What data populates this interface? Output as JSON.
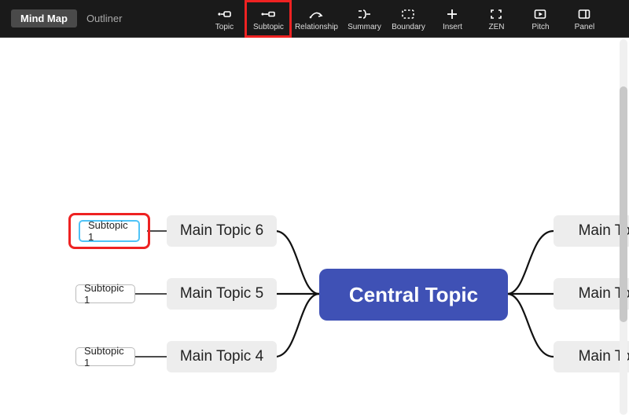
{
  "view_tabs": {
    "mindmap": "Mind Map",
    "outliner": "Outliner"
  },
  "tools": {
    "topic": "Topic",
    "subtopic": "Subtopic",
    "relationship": "Relationship",
    "summary": "Summary",
    "boundary": "Boundary",
    "insert": "Insert",
    "zen": "ZEN",
    "pitch": "Pitch",
    "panel": "Panel"
  },
  "nodes": {
    "central": "Central Topic",
    "left": [
      {
        "main": "Main Topic 6",
        "sub": "Subtopic 1"
      },
      {
        "main": "Main Topic 5",
        "sub": "Subtopic 1"
      },
      {
        "main": "Main Topic 4",
        "sub": "Subtopic 1"
      }
    ],
    "right": [
      {
        "main": "Main Top"
      },
      {
        "main": "Main Top"
      },
      {
        "main": "Main Top"
      }
    ]
  },
  "highlight": {
    "tool": "subtopic",
    "node": "left.0.sub"
  }
}
